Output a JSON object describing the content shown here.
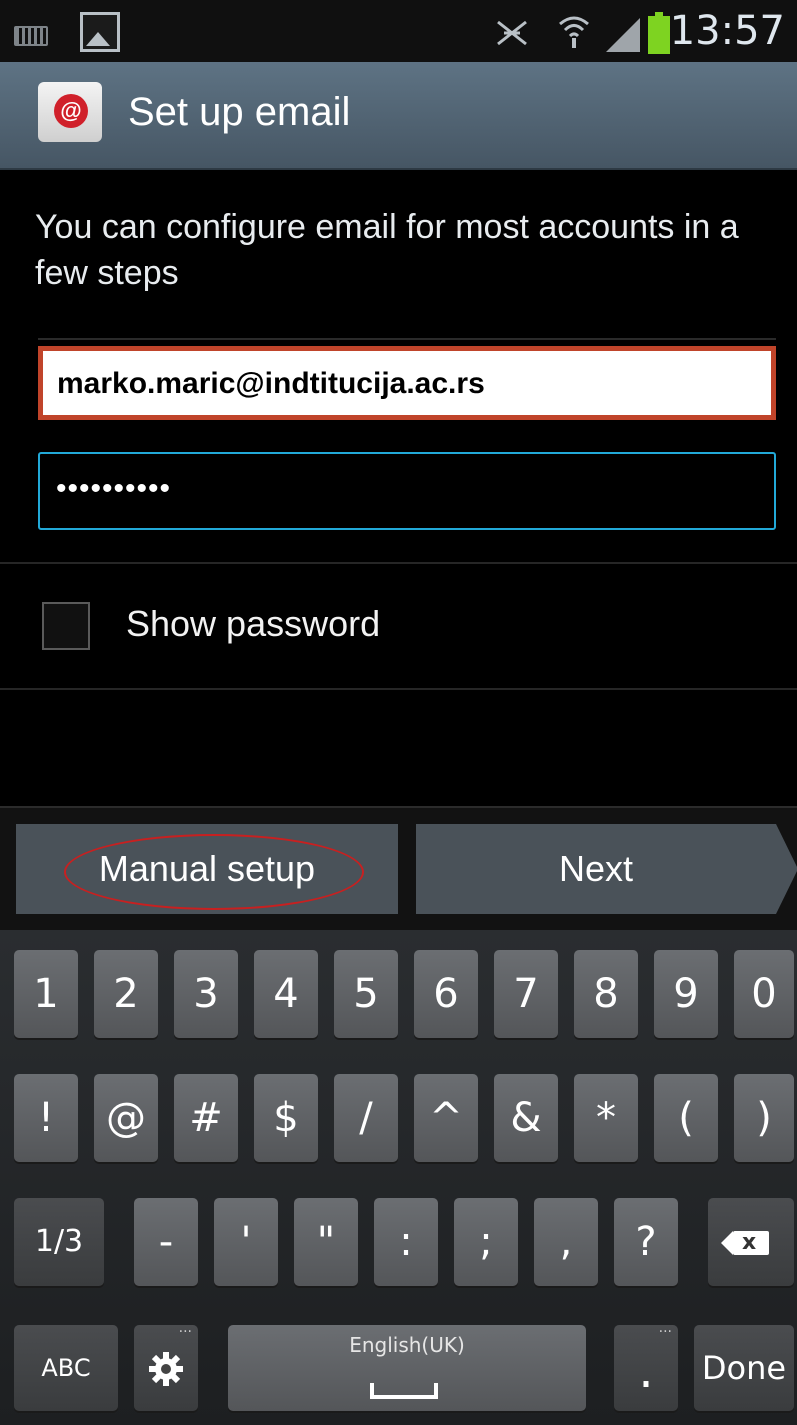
{
  "status_bar": {
    "time": "13:57",
    "icons": [
      "keyboard-icon",
      "image-icon",
      "silent-mode-icon",
      "wifi-icon",
      "signal-icon",
      "battery-icon"
    ],
    "battery_color": "#7ed321"
  },
  "action_bar": {
    "title": "Set up email",
    "icon": "email-app-icon",
    "icon_glyph": "@",
    "background": "#52677a"
  },
  "form": {
    "intro": "You can configure email for most accounts in a few steps",
    "email_value": "marko.maric@indtitucija.ac.rs",
    "password_value": "••••••••••",
    "show_password_label": "Show password",
    "show_password_checked": false,
    "focus_color": "#22a9d8",
    "highlight_color": "#c0442a"
  },
  "buttons": {
    "manual_setup": "Manual setup",
    "next": "Next"
  },
  "keyboard": {
    "row1": [
      "1",
      "2",
      "3",
      "4",
      "5",
      "6",
      "7",
      "8",
      "9",
      "0"
    ],
    "row2": [
      "!",
      "@",
      "#",
      "$",
      "/",
      "^",
      "&",
      "*",
      "(",
      ")"
    ],
    "row3": [
      "1/3",
      "-",
      "'",
      "\"",
      ":",
      ";",
      ",",
      "?"
    ],
    "row3_delete_glyph": "x",
    "abc_label": "ABC",
    "language_label": "English(UK)",
    "period_label": ".",
    "done_label": "Done",
    "more_dots": "···"
  }
}
